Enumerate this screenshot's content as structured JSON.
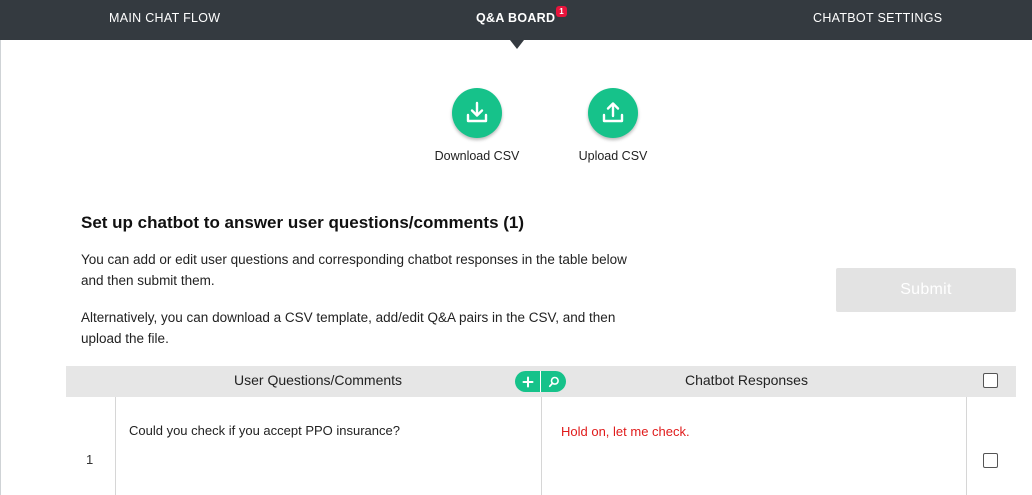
{
  "nav": {
    "items": [
      {
        "label": "MAIN CHAT FLOW"
      },
      {
        "label": "Q&A BOARD",
        "badge": "1",
        "active": true
      },
      {
        "label": "CHATBOT SETTINGS"
      }
    ]
  },
  "csv": {
    "download_label": "Download CSV",
    "download_icon": "download-icon",
    "upload_label": "Upload CSV",
    "upload_icon": "upload-icon"
  },
  "main": {
    "title": "Set up chatbot to answer user questions/comments (1)",
    "description_1": "You can add or edit user questions and corresponding chatbot responses in the table below and then submit them.",
    "description_2": "Alternatively, you can download a CSV template, add/edit Q&A pairs in the CSV, and then upload the file.",
    "submit_label": "Submit"
  },
  "table": {
    "col_questions": "User Questions/Comments",
    "col_responses": "Chatbot Responses",
    "tools": [
      "plus-icon",
      "search-icon"
    ],
    "rows": [
      {
        "number": "1",
        "question": "Could you check if you accept PPO insurance?",
        "response": "Hold on, let me check."
      }
    ]
  },
  "colors": {
    "nav_bg": "#343a40",
    "accent_green": "#16c28a",
    "badge_red": "#e8143c",
    "response_red": "#e01b1b",
    "submit_disabled": "#e3e3e3"
  }
}
